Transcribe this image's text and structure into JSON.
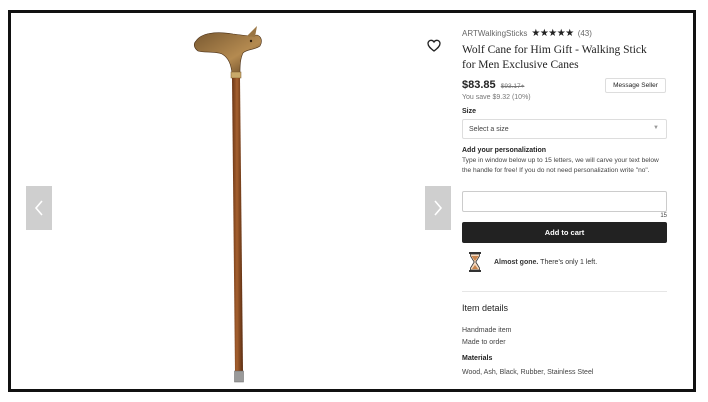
{
  "shop": {
    "name": "ARTWalkingSticks",
    "stars": "★★★★★",
    "reviews": "(43)"
  },
  "product": {
    "title": "Wolf Cane for Him Gift - Walking Stick for Men Exclusive Canes",
    "price": "$83.85",
    "old_price": "$93.17+",
    "savings": "You save $9.32 (10%)"
  },
  "message_seller": "Message Seller",
  "size": {
    "label": "Size",
    "placeholder": "Select a size"
  },
  "personalization": {
    "label": "Add your personalization",
    "instructions": "Type in window below up to 15 letters, we will carve your text below the handle for free! If you do not need personalization write \"no\".",
    "counter": "15"
  },
  "add_to_cart": "Add to cart",
  "scarcity": {
    "bold": "Almost gone.",
    "rest": " There's only 1 left."
  },
  "item_details": {
    "title": "Item details",
    "lines": [
      "Handmade item",
      "Made to order"
    ],
    "materials_label": "Materials",
    "materials": "Wood, Ash, Black, Rubber, Stainless Steel"
  },
  "colors": {
    "cart_button": "#222222",
    "nav_button": "#cfcfcf",
    "cane_wood": "#8a4a22",
    "hourglass": "#c8834a"
  },
  "icons": [
    "heart-icon",
    "chevron-left-icon",
    "chevron-right-icon",
    "hourglass-icon",
    "star-icon",
    "caret-down-icon"
  ]
}
